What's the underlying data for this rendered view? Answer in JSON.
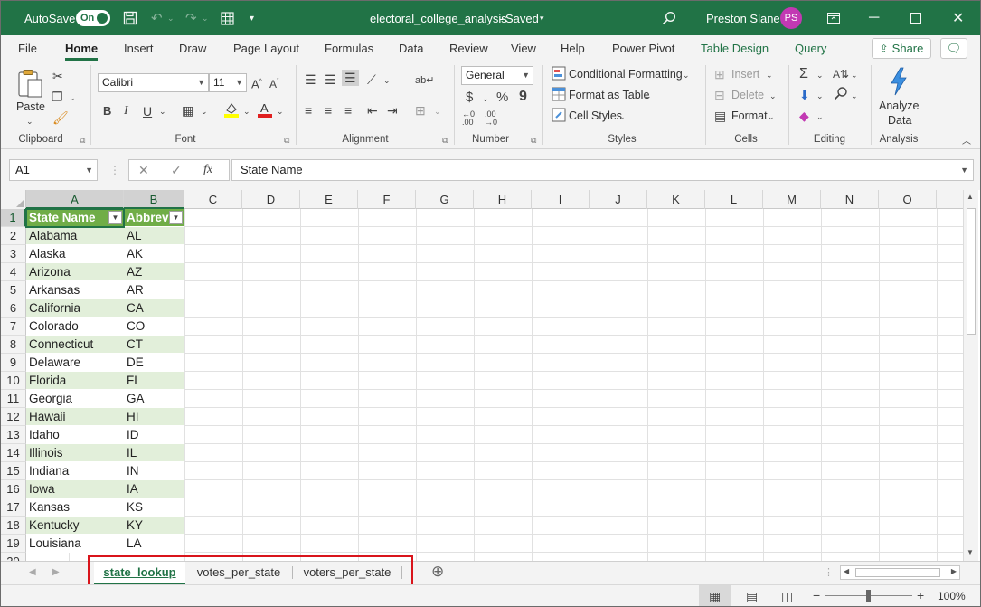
{
  "titlebar": {
    "autosave_label": "AutoSave",
    "autosave_state": "On",
    "file_title": "electoral_college_analysis",
    "saved_state": "Saved",
    "user_name": "Preston Slane",
    "user_initials": "PS"
  },
  "tabs": [
    "File",
    "Home",
    "Insert",
    "Draw",
    "Page Layout",
    "Formulas",
    "Data",
    "Review",
    "View",
    "Help",
    "Power Pivot",
    "Table Design",
    "Query"
  ],
  "active_tab": "Home",
  "share_label": "Share",
  "ribbon": {
    "clipboard": {
      "paste": "Paste",
      "label": "Clipboard"
    },
    "font": {
      "name": "Calibri",
      "size": "11",
      "label": "Font"
    },
    "alignment": {
      "label": "Alignment"
    },
    "number": {
      "format": "General",
      "label": "Number"
    },
    "styles": {
      "conditional": "Conditional Formatting",
      "format_table": "Format as Table",
      "cell_styles": "Cell Styles",
      "label": "Styles"
    },
    "cells": {
      "insert": "Insert",
      "delete": "Delete",
      "format": "Format",
      "label": "Cells"
    },
    "editing": {
      "label": "Editing"
    },
    "analysis": {
      "analyze_line1": "Analyze",
      "analyze_line2": "Data",
      "label": "Analysis"
    }
  },
  "formula_bar": {
    "name_box": "A1",
    "content": "State Name"
  },
  "columns": [
    "A",
    "B",
    "C",
    "D",
    "E",
    "F",
    "G",
    "H",
    "I",
    "J",
    "K",
    "L",
    "M",
    "N",
    "O"
  ],
  "rows": [
    "1",
    "2",
    "3",
    "4",
    "5",
    "6",
    "7",
    "8",
    "9",
    "10",
    "11",
    "12",
    "13",
    "14",
    "15",
    "16",
    "17",
    "18",
    "19",
    "20"
  ],
  "table": {
    "header": [
      "State Name",
      "Abbrev"
    ],
    "rows": [
      [
        "Alabama",
        "AL"
      ],
      [
        "Alaska",
        "AK"
      ],
      [
        "Arizona",
        "AZ"
      ],
      [
        "Arkansas",
        "AR"
      ],
      [
        "California",
        "CA"
      ],
      [
        "Colorado",
        "CO"
      ],
      [
        "Connecticut",
        "CT"
      ],
      [
        "Delaware",
        "DE"
      ],
      [
        "Florida",
        "FL"
      ],
      [
        "Georgia",
        "GA"
      ],
      [
        "Hawaii",
        "HI"
      ],
      [
        "Idaho",
        "ID"
      ],
      [
        "Illinois",
        "IL"
      ],
      [
        "Indiana",
        "IN"
      ],
      [
        "Iowa",
        "IA"
      ],
      [
        "Kansas",
        "KS"
      ],
      [
        "Kentucky",
        "KY"
      ],
      [
        "Louisiana",
        "LA"
      ]
    ]
  },
  "sheets": [
    "state_lookup",
    "votes_per_state",
    "voters_per_state"
  ],
  "active_sheet": "state_lookup",
  "zoom": "100%",
  "colors": {
    "excel_green": "#217346",
    "table_header": "#70ad47",
    "table_band": "#e2efda",
    "highlight_red": "#d9141b"
  }
}
